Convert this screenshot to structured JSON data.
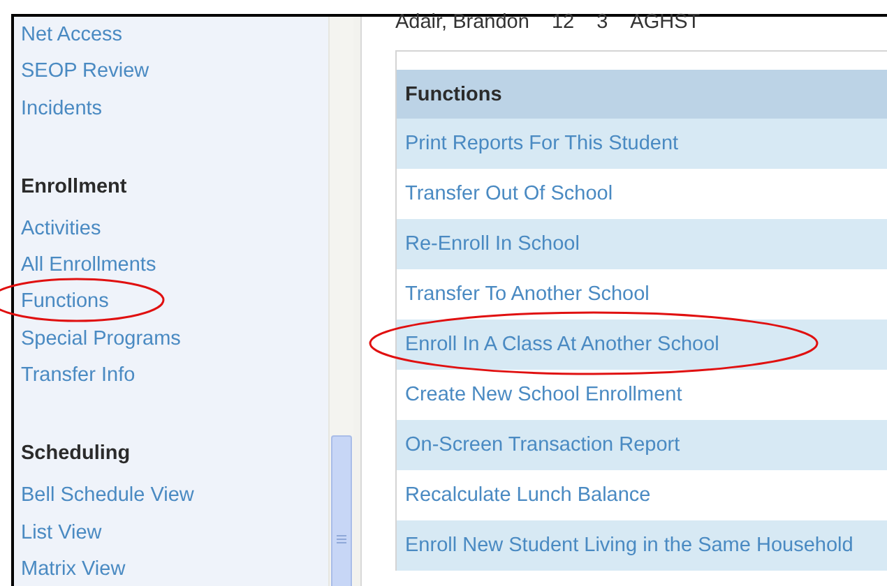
{
  "sidebar": {
    "sections": [
      {
        "items": [
          "Net Access",
          "SEOP Review",
          "Incidents"
        ]
      },
      {
        "heading": "Enrollment",
        "items": [
          "Activities",
          "All Enrollments",
          "Functions",
          "Special Programs",
          "Transfer Info"
        ]
      },
      {
        "heading": "Scheduling",
        "items": [
          "Bell Schedule View",
          "List View",
          "Matrix View"
        ]
      }
    ]
  },
  "student": {
    "name": "Adair, Brandon",
    "grade": "12",
    "track": "3",
    "school": "AGHST"
  },
  "functions": {
    "heading": "Functions",
    "items": [
      "Print Reports For This Student",
      "Transfer Out Of School",
      "Re-Enroll In School",
      "Transfer To Another School",
      "Enroll In A Class At Another School",
      "Create New School Enrollment",
      "On-Screen Transaction Report",
      "Recalculate Lunch Balance",
      "Enroll New Student Living in the Same Household"
    ]
  }
}
